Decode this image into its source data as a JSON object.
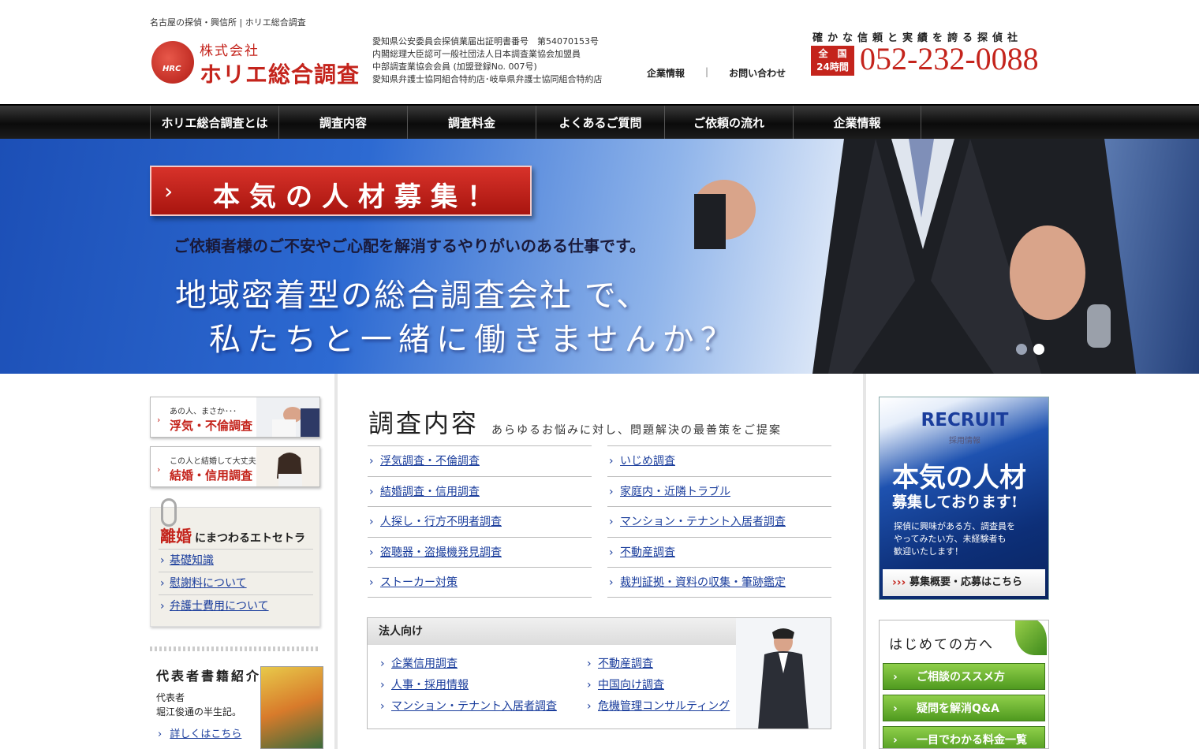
{
  "header": {
    "tagline": "名古屋の探偵・興信所 | ホリエ総合調査",
    "logo_emblem": "HRC",
    "logo_sub": "株式会社",
    "logo_main": "ホリエ総合調査",
    "licenses": [
      "愛知県公安委員会探偵業届出証明書番号　第54070153号",
      "内閣総理大臣認可一般社団法人日本調査業協会加盟員",
      "中部調査業協会会員 (加盟登録No. 007号)",
      "愛知県弁護士協同組合特約店･岐阜県弁護士協同組合特約店"
    ],
    "nav_company": "企業情報",
    "nav_sep": "|",
    "nav_contact": "お問い合わせ",
    "trust_text": "確かな信頼と実績を誇る探偵社",
    "badge_line1": "全　国",
    "badge_line2": "24時間",
    "phone": "052-232-0088"
  },
  "navbar": [
    "ホリエ総合調査とは",
    "調査内容",
    "調査料金",
    "よくあるご質問",
    "ご依頼の流れ",
    "企業情報"
  ],
  "hero": {
    "banner": "本気の人材募集！",
    "subtitle": "ご依頼者様のご不安やご心配を解消するやりがいのある仕事です。",
    "line1": "地域密着型の総合調査会社 で、",
    "line2": "私たちと一緒に働きませんか？",
    "slide_count": 2,
    "active_slide": 2
  },
  "left": {
    "box1_small": "あの人、まさか･･･",
    "box1_big": "浮気・不倫調査",
    "box2_small": "この人と結婚して大丈夫？",
    "box2_big": "結婚・信用調査",
    "divorce_word": "離婚",
    "divorce_rest": "にまつわるエトセトラ",
    "divorce_links": [
      "基礎知識",
      "慰謝料について",
      "弁護士費用について"
    ],
    "book_title": "代表者書籍紹介",
    "book_desc1": "代表者",
    "book_desc2": "堀江俊通の半生記。",
    "book_link": "詳しくはこちら"
  },
  "center": {
    "title": "調査内容",
    "subtitle": "あらゆるお悩みに対し、問題解決の最善策をご提案",
    "list_left": [
      "浮気調査・不倫調査",
      "結婚調査・信用調査",
      "人探し・行方不明者調査",
      "盗聴器・盗撮機発見調査",
      "ストーカー対策"
    ],
    "list_right": [
      "いじめ調査",
      "家庭内・近隣トラブル",
      "マンション・テナント入居者調査",
      "不動産調査",
      "裁判証拠・資料の収集・筆跡鑑定"
    ],
    "corp_head": "法人向け",
    "corp_left": [
      "企業信用調査",
      "人事・採用情報",
      "マンション・テナント入居者調査"
    ],
    "corp_right": [
      "不動産調査",
      "中国向け調査",
      "危機管理コンサルティング"
    ]
  },
  "right": {
    "recruit_head": "RECRUIT",
    "recruit_sub": "採用情報",
    "recruit_big": "本気の人材",
    "recruit_big2": "募集しております!",
    "recruit_desc1": "探偵に興味がある方、調査員を",
    "recruit_desc2": "やってみたい方、未経験者も",
    "recruit_desc3": "歓迎いたします！",
    "recruit_btn": "募集概要・応募はこちら",
    "beginner_title": "はじめての方へ",
    "beginner_btns": [
      "ご相談のススメ方",
      "疑問を解消Q&A",
      "一目でわかる料金一覧"
    ]
  },
  "colors": {
    "brand_red": "#c4241c",
    "link_blue": "#1a3d9c",
    "green": "#4f9a1f"
  }
}
